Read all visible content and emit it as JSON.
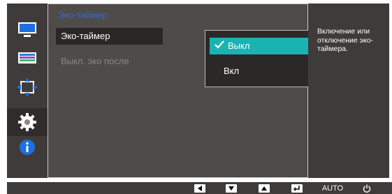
{
  "menu": {
    "title": "Эко-таймер",
    "items": [
      {
        "label": "Эко-таймер",
        "state": "active"
      },
      {
        "label": "Выкл. эко после",
        "state": "disabled"
      }
    ]
  },
  "dropdown": {
    "options": [
      {
        "label": "Выкл",
        "selected": true
      },
      {
        "label": "Вкл",
        "selected": false
      }
    ]
  },
  "help": {
    "text": "Включение или отключение эко-таймера."
  },
  "sidebar": {
    "icons": [
      "monitor-icon",
      "color-bars-icon",
      "position-arrows-icon",
      "gear-icon",
      "info-icon"
    ],
    "selected_index": 3
  },
  "bottom_bar": {
    "buttons": [
      {
        "icon": "left-arrow-icon"
      },
      {
        "icon": "down-arrow-icon"
      },
      {
        "icon": "up-arrow-icon"
      },
      {
        "icon": "enter-icon"
      },
      {
        "icon": "auto-text",
        "label": "AUTO"
      },
      {
        "icon": "power-icon"
      }
    ]
  },
  "colors": {
    "background": "#3e3b3a",
    "panel": "#4f4b49",
    "accent_blue": "#2f6bd6",
    "selection_teal": "#1ab3b3",
    "info_blue": "#1e6fe0"
  }
}
